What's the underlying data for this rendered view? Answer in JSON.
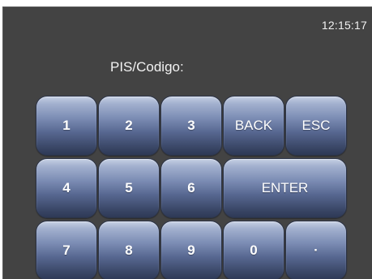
{
  "status": {
    "clock": "12:15:17"
  },
  "prompt": {
    "label": "PIS/Codigo:"
  },
  "keypad": {
    "digit_1": "1",
    "digit_2": "2",
    "digit_3": "3",
    "digit_4": "4",
    "digit_5": "5",
    "digit_6": "6",
    "digit_7": "7",
    "digit_8": "8",
    "digit_9": "9",
    "digit_0": "0",
    "dot": "·",
    "back": "BACK",
    "esc": "ESC",
    "enter": "ENTER"
  }
}
